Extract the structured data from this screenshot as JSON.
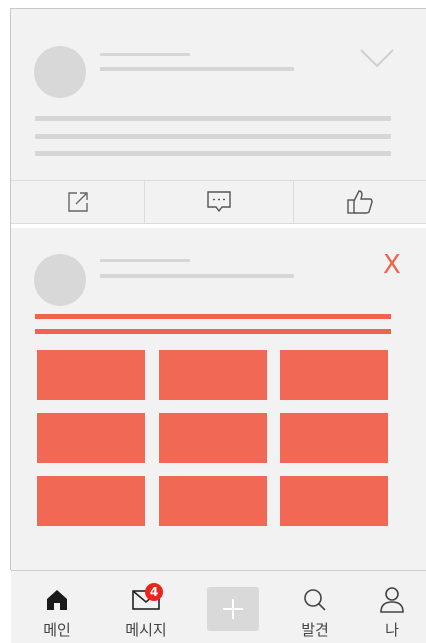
{
  "colors": {
    "accent": "#f0634e",
    "tile": "#f16955",
    "placeholder": "#d6d6d6",
    "badge": "#e8261d",
    "card": "#f2f2f2"
  },
  "feed": {
    "post1": {
      "avatar_icon": "avatar-placeholder",
      "menu_icon": "chevron-down-icon"
    },
    "actions": [
      {
        "icon": "share-icon"
      },
      {
        "icon": "comment-icon"
      },
      {
        "icon": "thumbs-up-icon"
      }
    ],
    "post2": {
      "close_label": "X",
      "tiles": 9
    }
  },
  "tabbar": {
    "items": [
      {
        "label": "메인",
        "icon": "home-icon"
      },
      {
        "label": "메시지",
        "icon": "mail-icon",
        "badge": "4"
      },
      {
        "label": "",
        "icon": "plus-icon"
      },
      {
        "label": "발견",
        "icon": "search-icon"
      },
      {
        "label": "나",
        "icon": "person-icon"
      }
    ]
  }
}
